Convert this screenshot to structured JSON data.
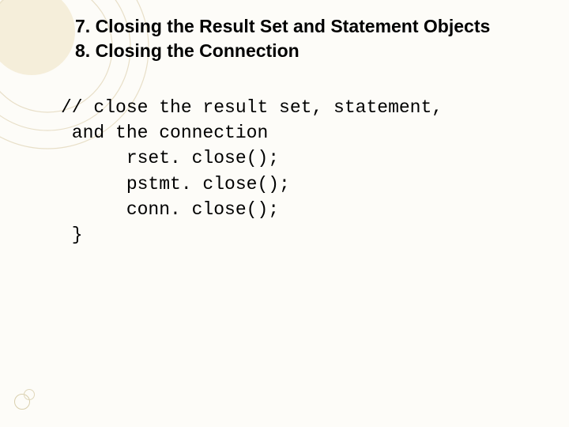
{
  "headings": {
    "line1": "7. Closing the Result Set and Statement Objects",
    "line2": "8. Closing the Connection"
  },
  "code": {
    "l1": "// close the result set, statement,",
    "l2": " and the connection",
    "l3": "      rset. close();",
    "l4": "      pstmt. close();",
    "l5": "      conn. close();",
    "l6": " }"
  }
}
